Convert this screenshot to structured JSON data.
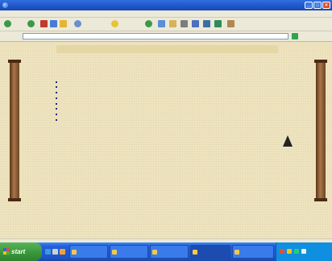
{
  "window": {
    "title": ""
  },
  "menu": [],
  "toolbar": {
    "back": "",
    "search": "",
    "favorites": ""
  },
  "address": {
    "label": "",
    "url": "",
    "go": ""
  },
  "page": {
    "nav": [],
    "links": [],
    "footer": ""
  },
  "taskbar": {
    "start": "start",
    "tasks": [],
    "clock": ""
  },
  "colors": {
    "accent": "#1f54c8",
    "page_bg": "#ede3bf",
    "link": "#1a2a7a",
    "column": "#7a4a26",
    "start_green": "#3c9a3c"
  }
}
